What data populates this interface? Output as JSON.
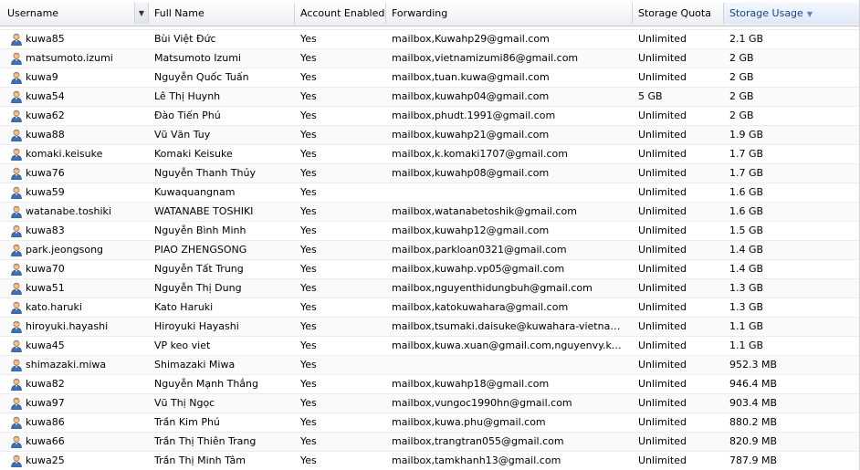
{
  "columns": [
    {
      "label": "Username",
      "key": "username"
    },
    {
      "label": "Full Name",
      "key": "full_name"
    },
    {
      "label": "Account Enabled",
      "key": "enabled"
    },
    {
      "label": "Forwarding",
      "key": "forwarding"
    },
    {
      "label": "Storage Quota",
      "key": "quota"
    },
    {
      "label": "Storage Usage",
      "key": "usage",
      "sorted": "desc"
    }
  ],
  "row_icon": "user-icon",
  "rows": [
    {
      "username": "kuwa85",
      "full_name": "Bùi Việt Đức",
      "enabled": "Yes",
      "forwarding": "mailbox,Kuwahp29@gmail.com",
      "quota": "Unlimited",
      "usage": "2.1 GB"
    },
    {
      "username": "matsumoto.izumi",
      "full_name": "Matsumoto Izumi",
      "enabled": "Yes",
      "forwarding": "mailbox,vietnamizumi86@gmail.com",
      "quota": "Unlimited",
      "usage": "2 GB"
    },
    {
      "username": "kuwa9",
      "full_name": "Nguyễn Quốc Tuấn",
      "enabled": "Yes",
      "forwarding": "mailbox,tuan.kuwa@gmail.com",
      "quota": "Unlimited",
      "usage": "2 GB"
    },
    {
      "username": "kuwa54",
      "full_name": "Lê Thị Huynh",
      "enabled": "Yes",
      "forwarding": "mailbox,kuwahp04@gmail.com",
      "quota": "5 GB",
      "usage": "2 GB"
    },
    {
      "username": "kuwa62",
      "full_name": "Đào Tiến Phú",
      "enabled": "Yes",
      "forwarding": "mailbox,phudt.1991@gmail.com",
      "quota": "Unlimited",
      "usage": "2 GB"
    },
    {
      "username": "kuwa88",
      "full_name": "Vũ Văn Tuy",
      "enabled": "Yes",
      "forwarding": "mailbox,kuwahp21@gmail.com",
      "quota": "Unlimited",
      "usage": "1.9 GB"
    },
    {
      "username": "komaki.keisuke",
      "full_name": "Komaki Keisuke",
      "enabled": "Yes",
      "forwarding": "mailbox,k.komaki1707@gmail.com",
      "quota": "Unlimited",
      "usage": "1.7 GB"
    },
    {
      "username": "kuwa76",
      "full_name": "Nguyễn Thanh Thủy",
      "enabled": "Yes",
      "forwarding": "mailbox,kuwahp08@gmail.com",
      "quota": "Unlimited",
      "usage": "1.7 GB"
    },
    {
      "username": "kuwa59",
      "full_name": "Kuwaquangnam",
      "enabled": "Yes",
      "forwarding": "",
      "quota": "Unlimited",
      "usage": "1.6 GB"
    },
    {
      "username": "watanabe.toshiki",
      "full_name": "WATANABE TOSHIKI",
      "enabled": "Yes",
      "forwarding": "mailbox,watanabetoshik@gmail.com",
      "quota": "Unlimited",
      "usage": "1.6 GB"
    },
    {
      "username": "kuwa83",
      "full_name": "Nguyễn Bình Minh",
      "enabled": "Yes",
      "forwarding": "mailbox,kuwahp12@gmail.com",
      "quota": "Unlimited",
      "usage": "1.5 GB"
    },
    {
      "username": "park.jeongsong",
      "full_name": "PIAO ZHENGSONG",
      "enabled": "Yes",
      "forwarding": "mailbox,parkloan0321@gmail.com",
      "quota": "Unlimited",
      "usage": "1.4 GB"
    },
    {
      "username": "kuwa70",
      "full_name": "Nguyễn Tất Trung",
      "enabled": "Yes",
      "forwarding": "mailbox,kuwahp.vp05@gmail.com",
      "quota": "Unlimited",
      "usage": "1.4 GB"
    },
    {
      "username": "kuwa51",
      "full_name": "Nguyễn Thị Dung",
      "enabled": "Yes",
      "forwarding": "mailbox,nguyenthidungbuh@gmail.com",
      "quota": "Unlimited",
      "usage": "1.3 GB"
    },
    {
      "username": "kato.haruki",
      "full_name": "Kato Haruki",
      "enabled": "Yes",
      "forwarding": "mailbox,katokuwahara@gmail.com",
      "quota": "Unlimited",
      "usage": "1.3 GB"
    },
    {
      "username": "hiroyuki.hayashi",
      "full_name": "Hiroyuki Hayashi",
      "enabled": "Yes",
      "forwarding": "mailbox,tsumaki.daisuke@kuwahara-vietnam.com",
      "quota": "Unlimited",
      "usage": "1.1 GB"
    },
    {
      "username": "kuwa45",
      "full_name": "VP keo viet",
      "enabled": "Yes",
      "forwarding": "mailbox,kuwa.xuan@gmail.com,nguyenvy.kuwa@…",
      "quota": "Unlimited",
      "usage": "1.1 GB"
    },
    {
      "username": "shimazaki.miwa",
      "full_name": "Shimazaki Miwa",
      "enabled": "Yes",
      "forwarding": "",
      "quota": "Unlimited",
      "usage": "952.3 MB"
    },
    {
      "username": "kuwa82",
      "full_name": "Nguyễn Mạnh Thắng",
      "enabled": "Yes",
      "forwarding": "mailbox,kuwahp18@gmail.com",
      "quota": "Unlimited",
      "usage": "946.4 MB"
    },
    {
      "username": "kuwa97",
      "full_name": "Vũ Thị Ngọc",
      "enabled": "Yes",
      "forwarding": "mailbox,vungoc1990hn@gmail.com",
      "quota": "Unlimited",
      "usage": "903.4 MB"
    },
    {
      "username": "kuwa86",
      "full_name": "Trần Kim Phú",
      "enabled": "Yes",
      "forwarding": "mailbox,kuwa.phu@gmail.com",
      "quota": "Unlimited",
      "usage": "880.2 MB"
    },
    {
      "username": "kuwa66",
      "full_name": "Trần Thị Thiên Trang",
      "enabled": "Yes",
      "forwarding": "mailbox,trangtran055@gmail.com",
      "quota": "Unlimited",
      "usage": "820.9 MB"
    },
    {
      "username": "kuwa25",
      "full_name": "Trần Thị Minh Tâm",
      "enabled": "Yes",
      "forwarding": "mailbox,tamkhanh13@gmail.com",
      "quota": "Unlimited",
      "usage": "787.9 MB"
    }
  ]
}
